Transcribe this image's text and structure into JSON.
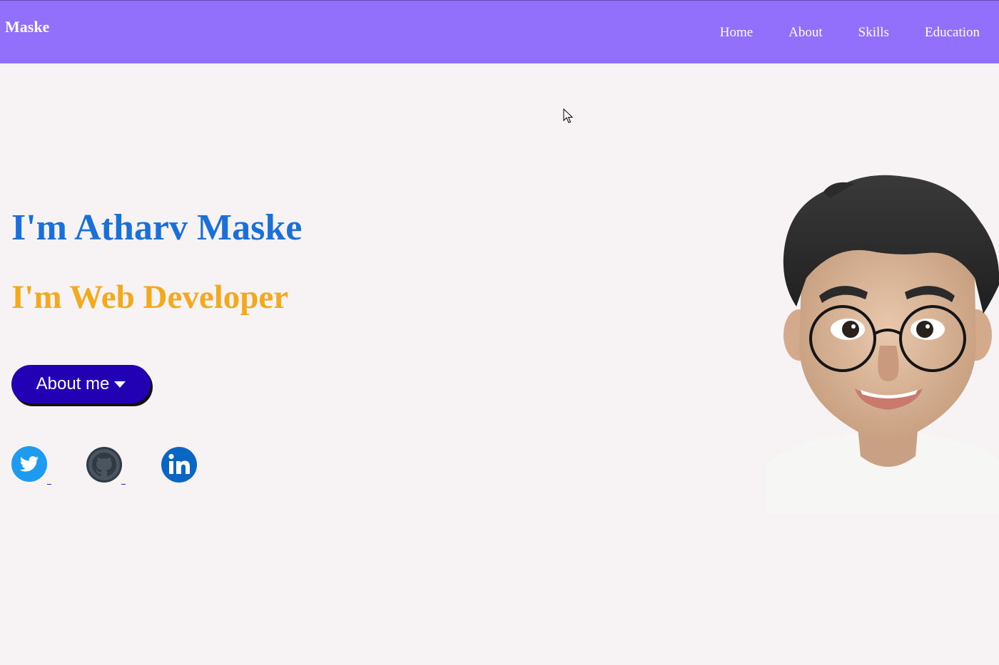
{
  "navbar": {
    "brand": "Maske",
    "links": [
      "Home",
      "About",
      "Skills",
      "Education"
    ],
    "background": "#9370fb"
  },
  "hero": {
    "title": "I'm Atharv Maske",
    "subtitle": "I'm Web Developer",
    "title_color": "#1a6fd8",
    "subtitle_color": "#f2a91d",
    "button_label": "About me",
    "button_icon": "caret-down-icon"
  },
  "social": [
    {
      "name": "twitter-icon",
      "color": "#1d9bf0"
    },
    {
      "name": "github-icon",
      "color": "#2e3a46"
    },
    {
      "name": "linkedin-icon",
      "color": "#0a66c2"
    }
  ],
  "avatar": {
    "name": "memoji-avatar"
  }
}
